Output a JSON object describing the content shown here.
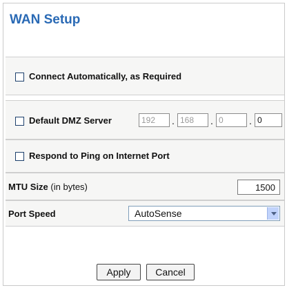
{
  "page": {
    "title": "WAN Setup"
  },
  "options": {
    "connect_auto": {
      "label": "Connect Automatically, as Required",
      "checked": false
    },
    "dmz": {
      "label": "Default DMZ Server",
      "checked": false,
      "ip": [
        "192",
        "168",
        "0",
        "0"
      ]
    },
    "ping": {
      "label": "Respond to Ping on Internet Port",
      "checked": false
    }
  },
  "mtu": {
    "label": "MTU Size",
    "unit": "(in bytes)",
    "value": "1500"
  },
  "port_speed": {
    "label": "Port Speed",
    "selected": "AutoSense"
  },
  "buttons": {
    "apply": "Apply",
    "cancel": "Cancel"
  },
  "colors": {
    "title": "#2a6ab5",
    "row_bg": "#f6f6f5",
    "checkbox_border": "#1c3f6b"
  }
}
